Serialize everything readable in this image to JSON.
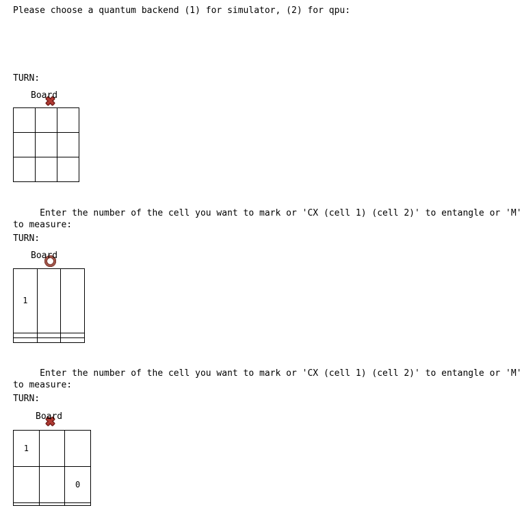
{
  "terminal": {
    "backend_prompt": "Please choose a quantum backend (1) for simulator, (2) for qpu:",
    "turn_label": "TURN:",
    "board_label": "Board",
    "input_prompt_line1": " Enter the number of the cell you want to mark or 'CX (cell 1) (cell 2)' to entangle or 'M'",
    "input_prompt_line2": "to measure:"
  },
  "marks": {
    "x_symbol": "cross-mark",
    "o_symbol": "hollow-red-circle",
    "x_color": "#b03a32",
    "x_outline": "#6e1c18",
    "o_color": "#a0564a",
    "o_outline": "#6e2a22"
  },
  "turns": [
    {
      "id": "turn-1",
      "player": "X",
      "player_symbol": "cross-mark",
      "board": [
        [
          "",
          "",
          ""
        ],
        [
          "",
          "",
          ""
        ],
        [
          "",
          "",
          ""
        ]
      ],
      "has_prompt": true
    },
    {
      "id": "turn-2",
      "player": "O",
      "player_symbol": "hollow-red-circle",
      "board": [
        [
          "1",
          "",
          ""
        ],
        [
          "",
          "",
          ""
        ],
        [
          "",
          "",
          ""
        ]
      ],
      "has_prompt": true
    },
    {
      "id": "turn-3",
      "player": "X",
      "player_symbol": "cross-mark",
      "board": [
        [
          "1",
          "",
          ""
        ],
        [
          "",
          "",
          "0"
        ],
        [
          "",
          "",
          ""
        ]
      ],
      "has_prompt": false
    }
  ]
}
